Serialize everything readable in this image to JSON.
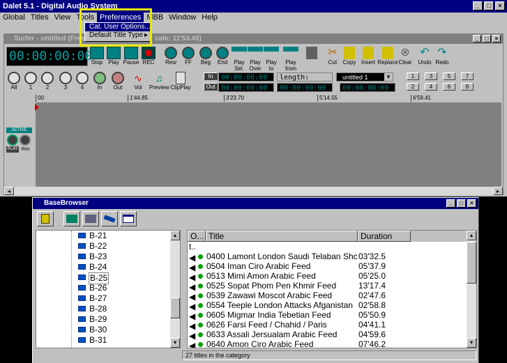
{
  "main": {
    "title": "Dalet 5.1 - Digital Audio System",
    "menu": [
      "Global",
      "Titles",
      "View",
      "Tools",
      "Preferences",
      "MBB",
      "Window",
      "Help"
    ],
    "active_menu": "Preferences",
    "dropdown": {
      "items": [
        {
          "label": "Cat. User Options..."
        },
        {
          "label": "Default Title Type"
        }
      ],
      "submenu_arrow": "▸"
    }
  },
  "surfer": {
    "title": "Surfer - untitled (Free",
    "title_tail": "cale: 11'53.46)",
    "timecode": "00:00:00:00",
    "transport": [
      "Stop",
      "Play",
      "Pause",
      "REC",
      "Rew",
      "FF",
      "Beg",
      "End"
    ],
    "edit_tools": [
      "Play Sel.",
      "Play Over",
      "Play to",
      "Play from",
      "",
      "Cut",
      "Copy",
      "Insert",
      "Replace",
      "Clear",
      "Undo",
      "Redo"
    ],
    "zoom": [
      "All",
      "1",
      "2",
      "3",
      "4",
      "In",
      "Out",
      "Vol",
      "Preview",
      "ClipPlay"
    ],
    "in_label": "In",
    "out_label": "Out",
    "small_tc": "00:00:00:00",
    "length_label": "length:",
    "combo_value": "untitled 1",
    "numbers_row1": [
      "1",
      "3",
      "5",
      "7"
    ],
    "numbers_row2": [
      "2",
      "4",
      "6",
      "8"
    ],
    "ruler": [
      "00",
      "1'44.85",
      "3'23.70",
      "5'14.55",
      "6'59.41"
    ],
    "track": {
      "badge": "ACTIVE",
      "play": "PLAY",
      "rec": "Rec"
    }
  },
  "browser": {
    "title": "BaseBrowser",
    "tree_items": [
      "B-21",
      "B-22",
      "B-23",
      "B-24",
      "B-25",
      "B-26",
      "B-27",
      "B-28",
      "B-29",
      "B-30",
      "B-31"
    ],
    "selected_tree": "B-25",
    "columns": [
      "O...",
      "Title",
      "Duration"
    ],
    "root_row": "t..",
    "rows": [
      {
        "title": "0400 Lamont London Saudi Telaban Shc",
        "duration": "03'32.5"
      },
      {
        "title": "0504 Iman Ciro Arabic Feed",
        "duration": "05'37.9"
      },
      {
        "title": "0513 Mimi Amon Arabic Feed",
        "duration": "05'25.0"
      },
      {
        "title": "0525 Sopat Phom Pen Khmir Feed",
        "duration": "13'17.4"
      },
      {
        "title": "0539 Zawawi  Moscot  Arabic Feed",
        "duration": "02'47.6"
      },
      {
        "title": "0554 Teeple London Attacks Afganistan",
        "duration": "02'58.8"
      },
      {
        "title": "0605 Migmar India Tebetian Feed",
        "duration": "05'50.9"
      },
      {
        "title": "0626 Farsi Feed / Chahid / Paris",
        "duration": "04'41.1"
      },
      {
        "title": "0633 Assali Jersualam Arabic Feed",
        "duration": "04'59.6"
      },
      {
        "title": "0640 Amon Ciro Arabic Feed",
        "duration": "07'46.2"
      }
    ],
    "status": "27 titles in the category"
  },
  "colors": {
    "titlebar": "#000080",
    "highlight": "#e8e800",
    "timecode": "#00a0a0"
  }
}
